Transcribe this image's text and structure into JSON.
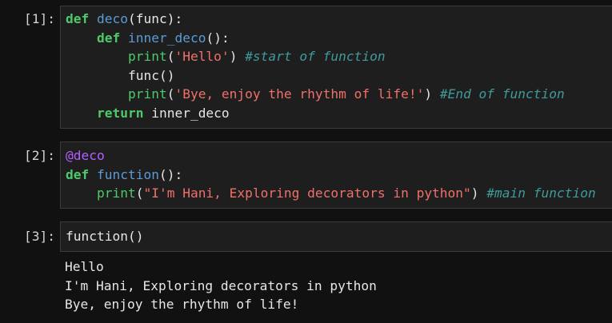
{
  "cells": [
    {
      "prompt": "[1]:",
      "lines": [
        [
          {
            "t": "def",
            "c": "kw"
          },
          {
            "t": " ",
            "c": "pl"
          },
          {
            "t": "deco",
            "c": "fn"
          },
          {
            "t": "(func):",
            "c": "pl"
          }
        ],
        [
          {
            "t": "    ",
            "c": "pl"
          },
          {
            "t": "def",
            "c": "kw"
          },
          {
            "t": " ",
            "c": "pl"
          },
          {
            "t": "inner_deco",
            "c": "fn"
          },
          {
            "t": "():",
            "c": "pl"
          }
        ],
        [
          {
            "t": "        ",
            "c": "pl"
          },
          {
            "t": "print",
            "c": "bi"
          },
          {
            "t": "(",
            "c": "pl"
          },
          {
            "t": "'Hello'",
            "c": "str"
          },
          {
            "t": ") ",
            "c": "pl"
          },
          {
            "t": "#start of function",
            "c": "cm"
          }
        ],
        [
          {
            "t": "        func()",
            "c": "pl"
          }
        ],
        [
          {
            "t": "        ",
            "c": "pl"
          },
          {
            "t": "print",
            "c": "bi"
          },
          {
            "t": "(",
            "c": "pl"
          },
          {
            "t": "'Bye, enjoy the rhythm of life!'",
            "c": "str"
          },
          {
            "t": ") ",
            "c": "pl"
          },
          {
            "t": "#End of function",
            "c": "cm"
          }
        ],
        [
          {
            "t": "    ",
            "c": "pl"
          },
          {
            "t": "return",
            "c": "kw"
          },
          {
            "t": " inner_deco",
            "c": "pl"
          }
        ]
      ],
      "outputs": []
    },
    {
      "prompt": "[2]:",
      "lines": [
        [
          {
            "t": "@deco",
            "c": "dec"
          }
        ],
        [
          {
            "t": "def",
            "c": "kw"
          },
          {
            "t": " ",
            "c": "pl"
          },
          {
            "t": "function",
            "c": "fn"
          },
          {
            "t": "():",
            "c": "pl"
          }
        ],
        [
          {
            "t": "    ",
            "c": "pl"
          },
          {
            "t": "print",
            "c": "bi"
          },
          {
            "t": "(",
            "c": "pl"
          },
          {
            "t": "\"I'm Hani, Exploring decorators in python\"",
            "c": "str"
          },
          {
            "t": ") ",
            "c": "pl"
          },
          {
            "t": "#main function",
            "c": "cm"
          }
        ]
      ],
      "outputs": []
    },
    {
      "prompt": "[3]:",
      "lines": [
        [
          {
            "t": "function()",
            "c": "pl"
          }
        ]
      ],
      "outputs": [
        "Hello",
        "I'm Hani, Exploring decorators in python",
        "Bye, enjoy the rhythm of life!"
      ]
    }
  ]
}
